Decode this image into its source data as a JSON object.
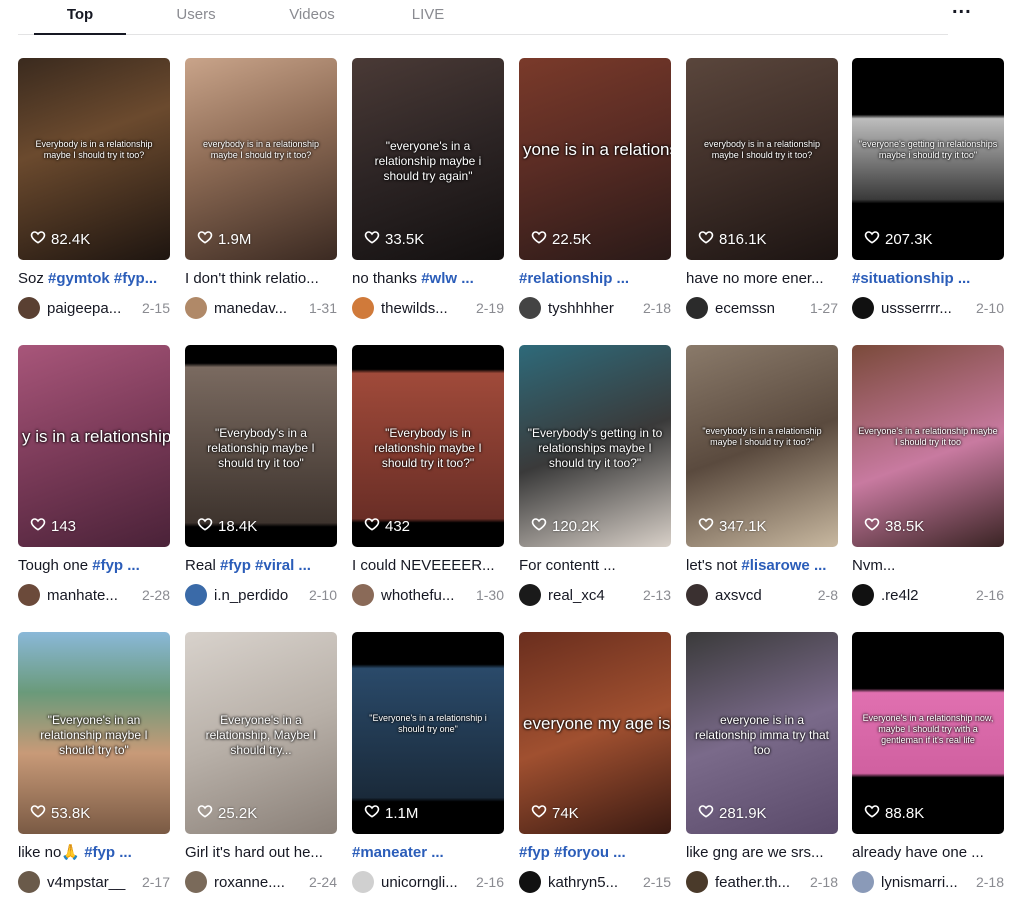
{
  "tabs": [
    {
      "label": "Top"
    },
    {
      "label": "Users"
    },
    {
      "label": "Videos"
    },
    {
      "label": "LIVE"
    }
  ],
  "more_label": "...",
  "videos": [
    {
      "overlay": "Everybody is in a relationship maybe I should try it too?",
      "likes": "82.4K",
      "desc_text": "Soz ",
      "desc_tags": "#gymtok #fyp...",
      "user": "paigeepa...",
      "date": "2-15",
      "bg": "linear-gradient(160deg,#3a2a1e 0%,#6b4a2e 40%,#1e1510 100%)",
      "avatar": "#5a4032"
    },
    {
      "overlay": "everybody is in a relationship maybe I should try it too?",
      "likes": "1.9M",
      "desc_text": "I don't think relatio...",
      "desc_tags": "",
      "user": "manedav...",
      "date": "1-31",
      "bg": "linear-gradient(160deg,#c9a48a 0%,#8c6a54 45%,#3b2a22 100%)",
      "avatar": "#b08968"
    },
    {
      "overlay": "\"everyone's in a relationship maybe i should try again\"",
      "likes": "33.5K",
      "desc_text": "no thanks ",
      "desc_tags": "#wlw ...",
      "user": "thewilds...",
      "date": "2-19",
      "bg": "linear-gradient(160deg,#4a3a36 0%,#2c2424 50%,#131010 100%)",
      "avatar": "#d07a3a"
    },
    {
      "overlay": "yone is in a relationship i should try it too",
      "likes": "22.5K",
      "desc_text": "",
      "desc_tags": "#relationship ...",
      "user": "tyshhhher",
      "date": "2-18",
      "bg": "linear-gradient(160deg,#7a3a2a 0%,#5a2c24 45%,#2a1a18 100%)",
      "avatar": "#444444"
    },
    {
      "overlay": "everybody is in a relationship maybe I should try it too?",
      "likes": "816.1K",
      "desc_text": "have no more ener...",
      "desc_tags": "",
      "user": "ecemssn",
      "date": "1-27",
      "bg": "linear-gradient(160deg,#5a463c 0%,#3e2e28 50%,#1c1412 100%)",
      "avatar": "#2b2b2b"
    },
    {
      "overlay": "\"everyone's getting in relationships maybe i should try it too\"",
      "likes": "207.3K",
      "desc_text": "",
      "desc_tags": "#situationship ...",
      "user": "ussserrrr...",
      "date": "2-10",
      "bg": "linear-gradient(180deg,#000 0%,#000 28%,#bdbdbd 30%,#3a3a3a 70%,#000 72%,#000 100%)",
      "avatar": "#111111"
    },
    {
      "overlay": "y is in a relationship, maybe",
      "likes": "143",
      "desc_text": "Tough one ",
      "desc_tags": "#fyp ...",
      "user": "manhate...",
      "date": "2-28",
      "bg": "linear-gradient(160deg,#a8567a 0%,#7a3a58 50%,#4a2238 100%)",
      "avatar": "#6b4a3a"
    },
    {
      "overlay": "\"Everybody's in a relationship maybe I should try it too\"",
      "likes": "18.4K",
      "desc_text": "Real ",
      "desc_tags": "#fyp #viral ...",
      "user": "i.n_perdido",
      "date": "2-10",
      "bg": "linear-gradient(180deg,#000 0%,#000 9%,#7a6a60 11%,#3e342e 88%,#000 90%)",
      "avatar": "#3a6aa8"
    },
    {
      "overlay": "\"Everybody is in relationship maybe I should try it too?\"",
      "likes": "432",
      "desc_text": "I could NEVEEEER...",
      "desc_tags": "",
      "user": "whothefu...",
      "date": "1-30",
      "bg": "linear-gradient(180deg,#000 0%,#000 12%,#a04a3a 14%,#6a2e26 86%,#000 88%)",
      "avatar": "#8a6a58"
    },
    {
      "overlay": "\"Everybody's getting in to relationships maybe I should try it too?\"",
      "likes": "120.2K",
      "desc_text": "For contentt ...",
      "desc_tags": "",
      "user": "real_xc4",
      "date": "2-13",
      "bg": "linear-gradient(160deg,#2e6a7a 0%,#3a3a3a 50%,#d8d0c8 100%)",
      "avatar": "#1a1a1a"
    },
    {
      "overlay": "\"everybody is in a relationship maybe I should try it too?\"",
      "likes": "347.1K",
      "desc_text": "let's not ",
      "desc_tags": "#lisarowe ...",
      "user": "axsvcd",
      "date": "2-8",
      "bg": "linear-gradient(160deg,#8a7a6a 0%,#5a4a3e 50%,#c8b8a0 100%)",
      "avatar": "#3a3030"
    },
    {
      "overlay": "Everyone's in a relationship maybe I should try it too",
      "likes": "38.5K",
      "desc_text": "Nvm... ",
      "desc_tags": "",
      "user": ".re4l2",
      "date": "2-16",
      "bg": "linear-gradient(160deg,#7a4a3a 0%,#c87aa0 55%,#3a2424 100%)",
      "avatar": "#111111"
    },
    {
      "overlay": "\"Everyone's in an relationship maybe I should try to\"",
      "likes": "53.8K",
      "desc_text": "like no🙏 ",
      "desc_tags": "#fyp ...",
      "user": "v4mpstar__",
      "date": "2-17",
      "bg": "linear-gradient(180deg,#8ab8d8 0%,#6a9a7a 30%,#c89a78 60%,#7a5a44 100%)",
      "avatar": "#6a5a4a"
    },
    {
      "overlay": "Everyone's in a relationship, Maybe I should try...",
      "likes": "25.2K",
      "desc_text": "Girl it's hard out he...",
      "desc_tags": "",
      "user": "roxanne....",
      "date": "2-24",
      "bg": "linear-gradient(160deg,#d8d2cc 0%,#b8b0a8 50%,#8a8078 100%)",
      "avatar": "#7a6a5a"
    },
    {
      "overlay": "\"Everyone's in a relationship i should try one\"",
      "likes": "1.1M",
      "desc_text": "",
      "desc_tags": "#maneater ...",
      "user": "unicorngli...",
      "date": "2-16",
      "bg": "linear-gradient(180deg,#000 0%,#000 16%,#2a4a6a 18%,#1a2a3a 82%,#000 84%)",
      "avatar": "#d0d0d0"
    },
    {
      "overlay": "everyone my age is in a relationship, maybe I should try it out too",
      "likes": "74K",
      "desc_text": "",
      "desc_tags": "#fyp #foryou ...",
      "user": "kathryn5...",
      "date": "2-15",
      "bg": "linear-gradient(160deg,#6a2e1e 0%,#a05030 50%,#3a1a12 100%)",
      "avatar": "#111111"
    },
    {
      "overlay": "everyone is in a relationship imma try that too",
      "likes": "281.9K",
      "desc_text": "like gng are we srs...",
      "desc_tags": "",
      "user": "feather.th...",
      "date": "2-18",
      "bg": "linear-gradient(160deg,#3a3a3a 0%,#7a6a8a 50%,#5a4a6a 100%)",
      "avatar": "#4a3a2a"
    },
    {
      "overlay": "Everyone's in a relationship now, maybe I should try with a gentleman if it's real life",
      "likes": "88.8K",
      "desc_text": "already have one ...",
      "desc_tags": "",
      "user": "lynismarri...",
      "date": "2-18",
      "bg": "linear-gradient(180deg,#000 0%,#000 28%,#e070b0 30%,#d060a0 70%,#000 72%,#000 100%)",
      "avatar": "#8a9ab8"
    }
  ]
}
